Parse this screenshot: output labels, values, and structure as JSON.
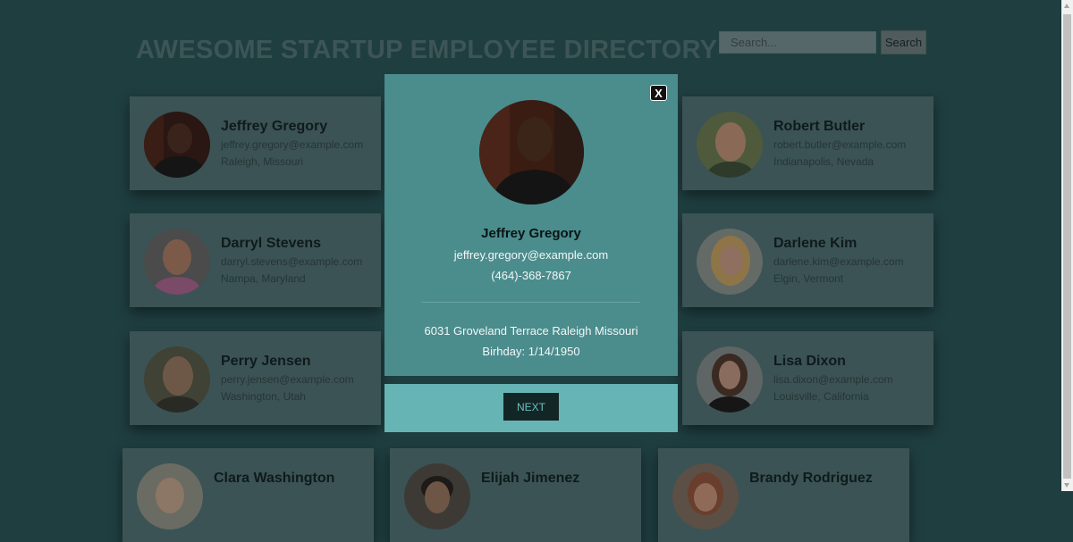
{
  "header": {
    "title": "AWESOME STARTUP EMPLOYEE DIRECTORY",
    "search_placeholder": "Search...",
    "search_button": "Search"
  },
  "employees": [
    {
      "name": "Jeffrey Gregory",
      "email": "jeffrey.gregory@example.com",
      "location": "Raleigh, Missouri"
    },
    {
      "name": "Robert Butler",
      "email": "robert.butler@example.com",
      "location": "Indianapolis, Nevada"
    },
    {
      "name": "Darryl Stevens",
      "email": "darryl.stevens@example.com",
      "location": "Nampa, Maryland"
    },
    {
      "name": "Darlene Kim",
      "email": "darlene.kim@example.com",
      "location": "Elgin, Vermont"
    },
    {
      "name": "Perry Jensen",
      "email": "perry.jensen@example.com",
      "location": "Washington, Utah"
    },
    {
      "name": "Lisa Dixon",
      "email": "lisa.dixon@example.com",
      "location": "Louisville, California"
    },
    {
      "name": "Clara Washington",
      "email": "",
      "location": ""
    },
    {
      "name": "Elijah Jimenez",
      "email": "",
      "location": ""
    },
    {
      "name": "Brandy Rodriguez",
      "email": "",
      "location": ""
    }
  ],
  "modal": {
    "close_label": "X",
    "name": "Jeffrey Gregory",
    "email": "jeffrey.gregory@example.com",
    "phone": "(464)-368-7867",
    "address": "6031 Groveland Terrace Raleigh Missouri",
    "birthday": "Birhday: 1/14/1950",
    "next_label": "NEXT"
  },
  "colors": {
    "page_background": "#1f3e40",
    "card_background": "#3b5355",
    "modal_background": "#4b8c8d",
    "nav_background": "#67b4b5",
    "next_button": "#132626"
  }
}
